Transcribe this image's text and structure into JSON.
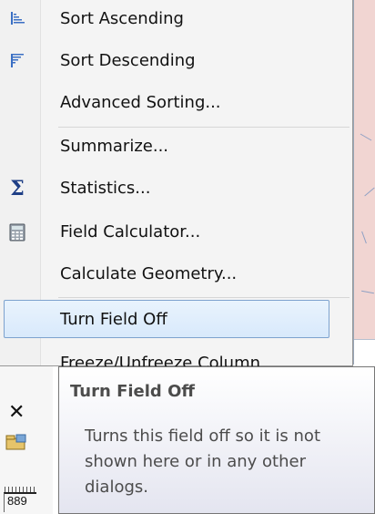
{
  "menu": {
    "items": [
      {
        "label": "Sort Ascending",
        "icon": "sort-ascending-icon"
      },
      {
        "label": "Sort Descending",
        "icon": "sort-descending-icon"
      },
      {
        "label": "Advanced Sorting...",
        "icon": ""
      },
      {
        "label": "Summarize...",
        "icon": ""
      },
      {
        "label": "Statistics...",
        "icon": "sigma-icon"
      },
      {
        "label": "Field Calculator...",
        "icon": "calculator-icon"
      },
      {
        "label": "Calculate Geometry...",
        "icon": ""
      },
      {
        "label": "Turn Field Off",
        "icon": "",
        "state": "hover"
      },
      {
        "label": "Freeze/Unfreeze Column",
        "icon": ""
      }
    ]
  },
  "tooltip": {
    "title": "Turn Field Off",
    "body": "Turns this field off so it is not shown here or in any other dialogs."
  },
  "background": {
    "row_number": "889",
    "icons": [
      "delete-x-icon",
      "properties-icon"
    ]
  },
  "colors": {
    "hover_fill": "#dbeafc",
    "hover_border": "#7da2ce",
    "tooltip_text": "#4c4c4c",
    "menu_bg": "#f4f4f4"
  }
}
